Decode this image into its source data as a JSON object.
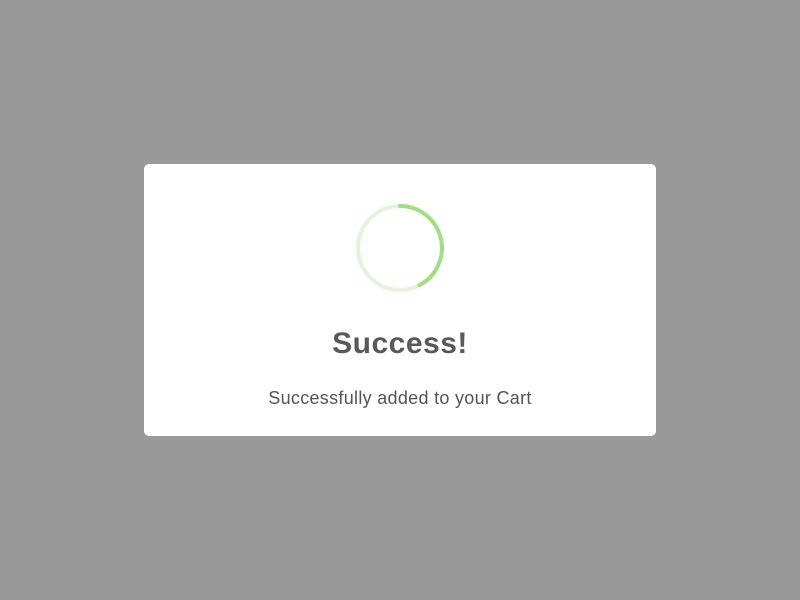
{
  "dialog": {
    "title": "Success!",
    "message": "Successfully added to your Cart",
    "icon": "success-spinner-icon"
  },
  "colors": {
    "overlay": "#999999",
    "modal_background": "#ffffff",
    "accent": "#a5dc86",
    "accent_light": "#e4f4dc",
    "title_text": "#595959",
    "message_text": "#545454"
  }
}
